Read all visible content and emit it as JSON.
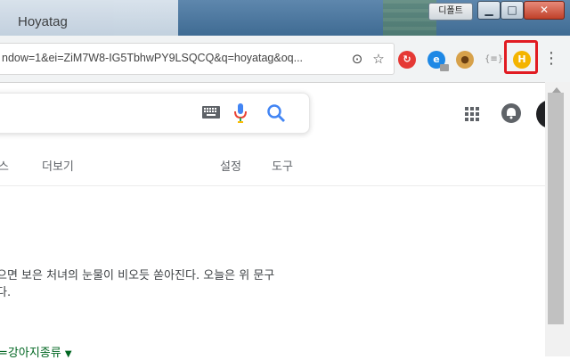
{
  "window": {
    "tab_title": "Hoyatag",
    "profile_label": "디폴트",
    "min_glyph": "▁",
    "max_glyph": "□",
    "close_glyph": "✕"
  },
  "omnibox": {
    "url": "ndow=1&ei=ZiM7W8-IG5TbhwPY9LSQCQ&q=hoyatag&oq...",
    "icons": [
      "location-icon",
      "star-icon"
    ]
  },
  "extensions": [
    {
      "name": "red-extension-icon",
      "glyph": "↻"
    },
    {
      "name": "globe-extension-icon",
      "glyph": "e"
    },
    {
      "name": "cookie-extension-icon",
      "glyph": "●"
    },
    {
      "name": "braces-extension-icon",
      "glyph": "{≡}"
    },
    {
      "name": "hoyatag-extension-icon",
      "glyph": "H"
    }
  ],
  "search": {
    "keyboard_icon": "keyboard-icon",
    "mic_icon": "mic-icon",
    "search_icon": "search-icon"
  },
  "nav": {
    "items": [
      "스",
      "더보기",
      "설정",
      "도구"
    ]
  },
  "result": {
    "snippet_line1": "으면 보은 처녀의 눈물이 비오듯 쏟아진다. 오늘은 위 문구",
    "snippet_line2": "다.",
    "link_text": "=강아지종류",
    "link_caret": "▼"
  },
  "colors": {
    "highlight": "#e11b22",
    "link_green": "#006621",
    "google_blue": "#4285f4"
  }
}
